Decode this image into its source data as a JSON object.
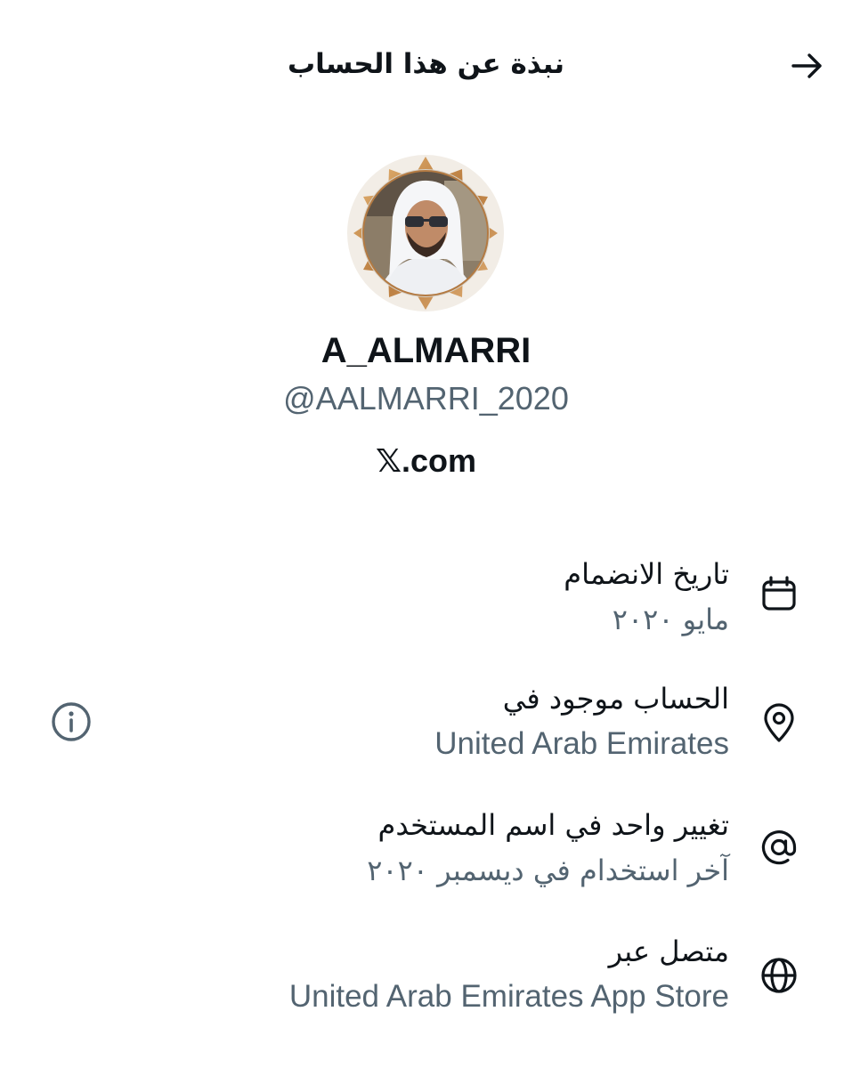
{
  "header": {
    "title": "نبذة عن هذا الحساب",
    "back_icon": "arrow-right-icon"
  },
  "profile": {
    "display_name": "A_ALMARRI",
    "handle": "@AALMARRI_2020",
    "site": "𝕏.com"
  },
  "details": [
    {
      "icon": "calendar-icon",
      "label": "تاريخ الانضمام",
      "value": "مايو ٢٠٢٠"
    },
    {
      "icon": "location-pin-icon",
      "label": "الحساب موجود في",
      "value": "United Arab Emirates",
      "extra_icon": "info-icon"
    },
    {
      "icon": "at-sign-icon",
      "label": "تغيير واحد في اسم المستخدم",
      "value": "آخر استخدام في ديسمبر ٢٠٢٠"
    },
    {
      "icon": "globe-icon",
      "label": "متصل عبر",
      "value": "United Arab Emirates App Store"
    }
  ],
  "colors": {
    "primary_text": "#0f1419",
    "secondary_text": "#536471",
    "avatar_frame": "#c9924f"
  }
}
